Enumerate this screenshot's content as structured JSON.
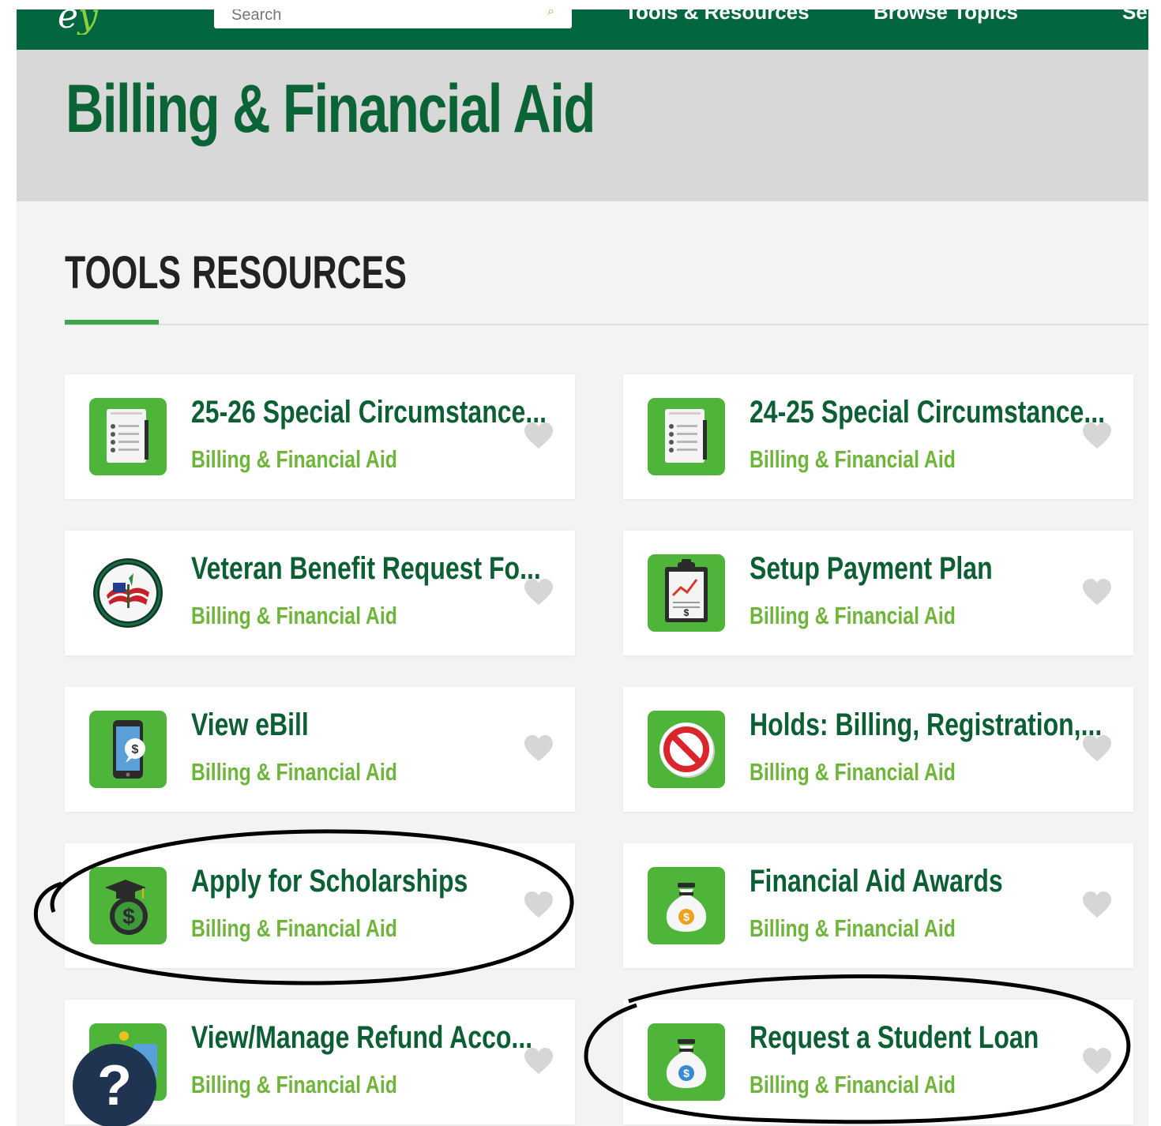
{
  "nav": {
    "logo_text": "e",
    "logo_accent": "y",
    "search_placeholder": "Search",
    "links": [
      "Tools & Resources",
      "Browse Topics",
      "Se"
    ]
  },
  "page": {
    "title": "Billing & Financial Aid"
  },
  "tabs": [
    {
      "label": "TOOLS",
      "active": true
    },
    {
      "label": "RESOURCES",
      "active": false
    }
  ],
  "cards": [
    {
      "title": "25-26 Special Circumstance...",
      "category": "Billing & Financial Aid",
      "icon": "document-list-icon"
    },
    {
      "title": "24-25 Special Circumstance...",
      "category": "Billing & Financial Aid",
      "icon": "document-list-icon"
    },
    {
      "title": "Veteran Benefit Request Fo...",
      "category": "Billing & Financial Aid",
      "icon": "veterans-seal-icon"
    },
    {
      "title": "Setup Payment Plan",
      "category": "Billing & Financial Aid",
      "icon": "clipboard-chart-icon"
    },
    {
      "title": "View eBill",
      "category": "Billing & Financial Aid",
      "icon": "phone-dollar-icon"
    },
    {
      "title": "Holds: Billing, Registration,...",
      "category": "Billing & Financial Aid",
      "icon": "no-symbol-icon"
    },
    {
      "title": "Apply for Scholarships",
      "category": "Billing & Financial Aid",
      "icon": "grad-cap-dollar-icon"
    },
    {
      "title": "Financial Aid Awards",
      "category": "Billing & Financial Aid",
      "icon": "money-bag-icon"
    },
    {
      "title": "View/Manage Refund Acco...",
      "category": "Billing & Financial Aid",
      "icon": "refund-account-icon"
    },
    {
      "title": "Request a Student Loan",
      "category": "Billing & Financial Aid",
      "icon": "money-bag-blue-icon"
    }
  ],
  "colors": {
    "nav_green": "#02673f",
    "title_green": "#0b6436",
    "category_green": "#6fb43b",
    "tile_green": "#4fb43a",
    "tab_underline": "#3aa84a"
  },
  "help_button": {
    "label": "?"
  }
}
